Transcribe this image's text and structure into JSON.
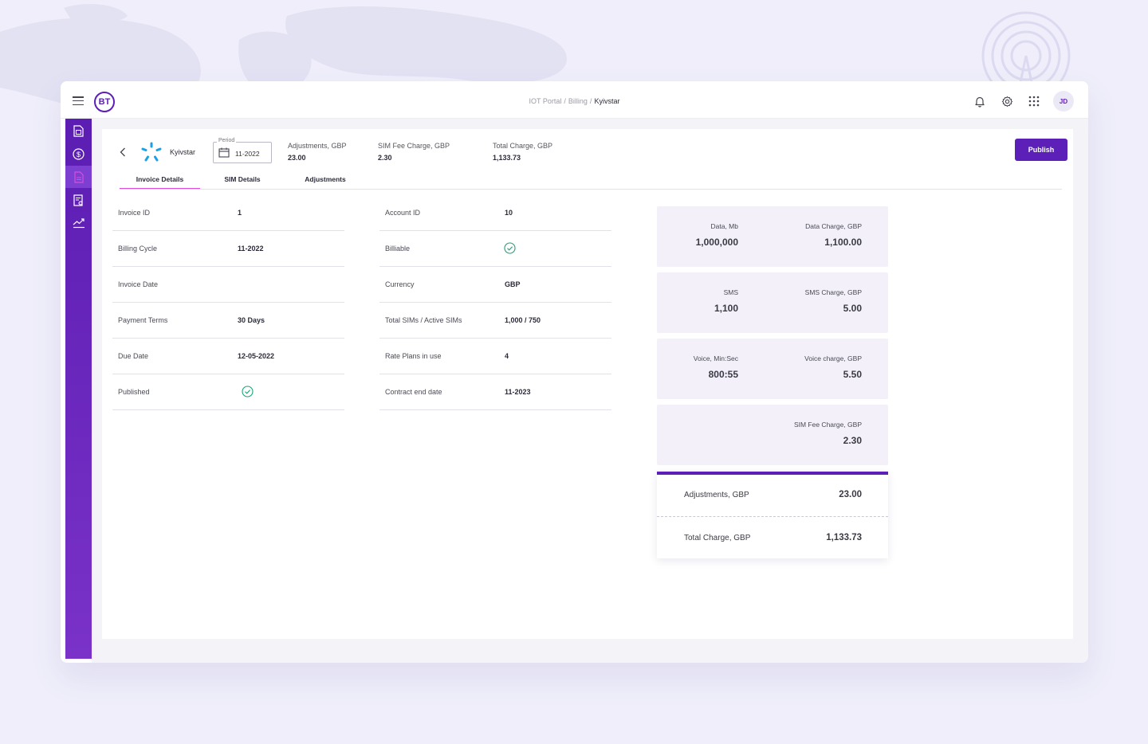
{
  "breadcrumb": {
    "items": [
      "IOT Portal",
      "Billing"
    ],
    "current": "Kyivstar"
  },
  "logo": {
    "text": "BT"
  },
  "user": {
    "initials": "JD"
  },
  "icons": {
    "menu": "hamburger-menu-icon",
    "notifications": "bell-icon",
    "settings": "gear-icon",
    "apps": "grid-apps-icon",
    "sidebar": [
      "sim-card-icon",
      "dollar-icon",
      "document-icon",
      "report-icon",
      "trend-chart-icon"
    ]
  },
  "header": {
    "operator": "Kyivstar",
    "period_label": "Period",
    "period_value": "11-2022",
    "summaries": [
      {
        "label": "Adjustments, GBP",
        "value": "23.00"
      },
      {
        "label": "SIM Fee Charge, GBP",
        "value": "2.30"
      },
      {
        "label": "Total Charge, GBP",
        "value": "1,133.73"
      }
    ],
    "publish_label": "Publish"
  },
  "tabs": [
    "Invoice Details",
    "SIM Details",
    "Adjustments"
  ],
  "left_fields": [
    {
      "label": "Invoice ID",
      "value": "1"
    },
    {
      "label": "Billing Cycle",
      "value": "11-2022"
    },
    {
      "label": "Invoice Date",
      "value": ""
    },
    {
      "label": "Payment Terms",
      "value": "30 Days"
    },
    {
      "label": "Due Date",
      "value": "12-05-2022"
    },
    {
      "label": "Published",
      "value": "",
      "check": true
    }
  ],
  "right_fields": [
    {
      "label": "Account  ID",
      "value": "10"
    },
    {
      "label": "Billiable",
      "value": "",
      "check": true
    },
    {
      "label": "Currency",
      "value": "GBP"
    },
    {
      "label": "Total SIMs / Active SIMs",
      "value": "1,000 / 750"
    },
    {
      "label": "Rate Plans in use",
      "value": "4"
    },
    {
      "label": "Contract end date",
      "value": "11-2023"
    }
  ],
  "charges": [
    {
      "qty_label": "Data, Mb",
      "qty_value": "1,000,000",
      "charge_label": "Data Charge, GBP",
      "charge_value": "1,100.00"
    },
    {
      "qty_label": "SMS",
      "qty_value": "1,100",
      "charge_label": "SMS Charge, GBP",
      "charge_value": "5.00"
    },
    {
      "qty_label": "Voice, Min:Sec",
      "qty_value": "800:55",
      "charge_label": "Voice charge, GBP",
      "charge_value": "5.50"
    },
    {
      "charge_label": "SIM Fee Charge, GBP",
      "charge_value": "2.30"
    }
  ],
  "totals": [
    {
      "label": "Adjustments, GBP",
      "value": "23.00"
    },
    {
      "label": "Total Charge, GBP",
      "value": "1,133.73"
    }
  ],
  "colors": {
    "primary": "#5c1fb8",
    "tab_active": "#d94fd9",
    "check": "#1aa575",
    "card_bg": "#f3f0f9"
  }
}
